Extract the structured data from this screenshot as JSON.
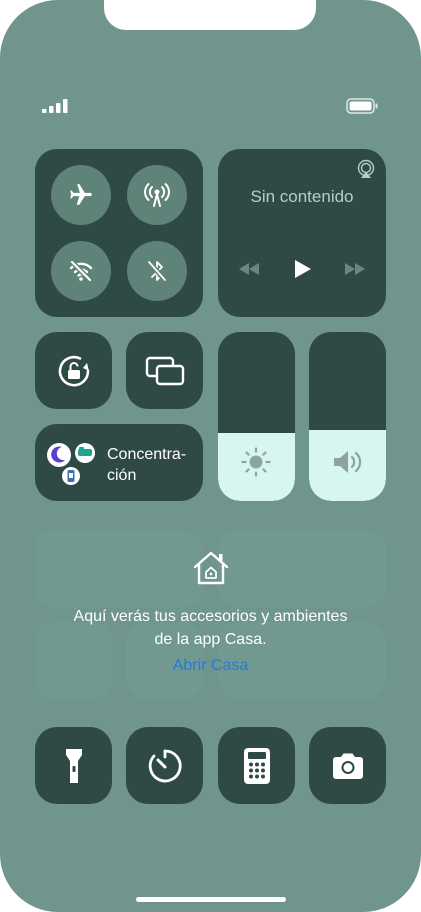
{
  "media": {
    "title": "Sin contenido"
  },
  "focus": {
    "label": "Concentra-\nción"
  },
  "home": {
    "message_line1": "Aquí verás tus accesorios y ambientes",
    "message_line2": "de la app Casa.",
    "link": "Abrir Casa"
  },
  "sliders": {
    "brightness_level": 0.4,
    "volume_level": 0.42
  },
  "colors": {
    "background": "#6f958d",
    "tile": "#2f4a44",
    "circle_button": "#5f8279",
    "slider_fill": "#d6f6ef",
    "link": "#1f7de0",
    "focus_moon_bg": "#ffffff",
    "focus_moon": "#5b3fcf",
    "focus_bed": "#1aa68f",
    "focus_badge": "#3a6fb5"
  },
  "icons": {
    "signal": "signal-bars-icon",
    "battery": "battery-icon",
    "airplane": "airplane-icon",
    "cellular": "antenna-icon",
    "wifi": "wifi-off-icon",
    "bluetooth": "bluetooth-off-icon",
    "airplay": "airplay-icon",
    "rewind": "rewind-icon",
    "play": "play-icon",
    "forward": "fast-forward-icon",
    "rotation_lock": "rotation-lock-icon",
    "screen_mirroring": "screen-mirroring-icon",
    "brightness": "sun-icon",
    "volume": "speaker-icon",
    "home": "house-icon",
    "flashlight": "flashlight-icon",
    "timer": "timer-icon",
    "calculator": "calculator-icon",
    "camera": "camera-icon"
  }
}
